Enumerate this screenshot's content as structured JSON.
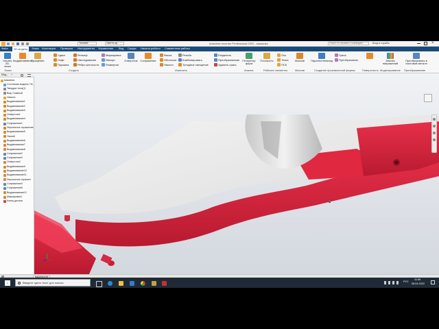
{
  "window": {
    "title": "Autodesk Inventor Professional 2022 - машинка",
    "search_placeholder": "Поиск по справке и командам...",
    "signin": "Вход в службы"
  },
  "quick_access": {
    "material": "Типовой",
    "appearance": "Светло-кр..."
  },
  "menu": [
    "Файл",
    "3D-модель",
    "Эскиз",
    "Аннотация",
    "Проверка",
    "Инструменты",
    "Управление",
    "Вид",
    "Среды",
    "Начало работы",
    "Совместная работа"
  ],
  "ribbon": {
    "sketch": {
      "label": "Начать 2D-эскиз",
      "group": "Эскиз"
    },
    "create": {
      "extrude": "Выдавливание",
      "revolve": "Вращение",
      "sweep": "Сдвиг",
      "loft": "Лофт",
      "coil": "Пружина",
      "emboss": "Рельеф",
      "derive": "Наследование",
      "rib": "Ребро жесткости",
      "decal": "Маркировка",
      "import": "Импорт",
      "unwrap": "Развертка",
      "group": "Создать"
    },
    "modify": {
      "hole": "Отверстие",
      "fillet": "Сопряжение",
      "chamfer": "Фаска",
      "shell": "Оболочка",
      "draft": "Наклон",
      "thread": "Резьба",
      "combine": "Комбинировать",
      "thicken": "Толщина/ смещение",
      "split": "Разделить",
      "direct": "Преобразование",
      "delete_face": "Удалить грань",
      "group": "Изменить"
    },
    "explore": {
      "label": "Генератор форм",
      "group": "Анализ"
    },
    "workfeatures": {
      "plane": "Плоскость",
      "axis": "Ось",
      "point": "Точка",
      "ucs": "ПСК",
      "group": "Рабочие элементы"
    },
    "pattern": {
      "label": "Массив",
      "group": "Массив"
    },
    "freeform": {
      "box": "Параллелепипед",
      "face": "Грань",
      "convert": "Преобразовать",
      "group": "Создание произвольной формы"
    },
    "surface": {
      "label": "Поверхность",
      "group": "Поверхность"
    },
    "simulation": {
      "label": "Анализ напряжений",
      "group": "Моделирование"
    },
    "convert": {
      "label": "Преобразовать в листовой металл",
      "group": "Преобразование"
    }
  },
  "browser": {
    "tabs": [
      "Мод...",
      "+"
    ],
    "items": [
      "машинка",
      "Состояния модели: Пе",
      "Твердые тела(1)",
      "Вид: Главный",
      "Начало",
      "Выдавливание1",
      "Выдавливание2",
      "Выдавливание3",
      "Отверстие1",
      "Выдавливание4",
      "Сопряжение1",
      "Зеркальное отражение",
      "Выдавливание5",
      "Эскиз8",
      "Выдавливание6",
      "Выдавливание7",
      "Выдавливание8",
      "Сопряжение2",
      "Сопряжение3",
      "Отверстие2",
      "Выдавливание9",
      "Выдавливание10",
      "Выдавливание11",
      "Зеркальное отражен",
      "Сопряжение4",
      "Сопряжение5",
      "Выдавливание12",
      "Маркировка1",
      "Конец детали"
    ]
  },
  "document_tab": "машинка.ipt",
  "status": "Режим ожидания",
  "taskbar": {
    "search_placeholder": "Введите здесь текст для поиска",
    "time": "11:59",
    "date": "08.04.2022",
    "lang": "РУС"
  },
  "colors": {
    "part_red": "#d9203a",
    "ribbon_blue": "#1a4a7a",
    "taskbar": "#1f2a36"
  }
}
